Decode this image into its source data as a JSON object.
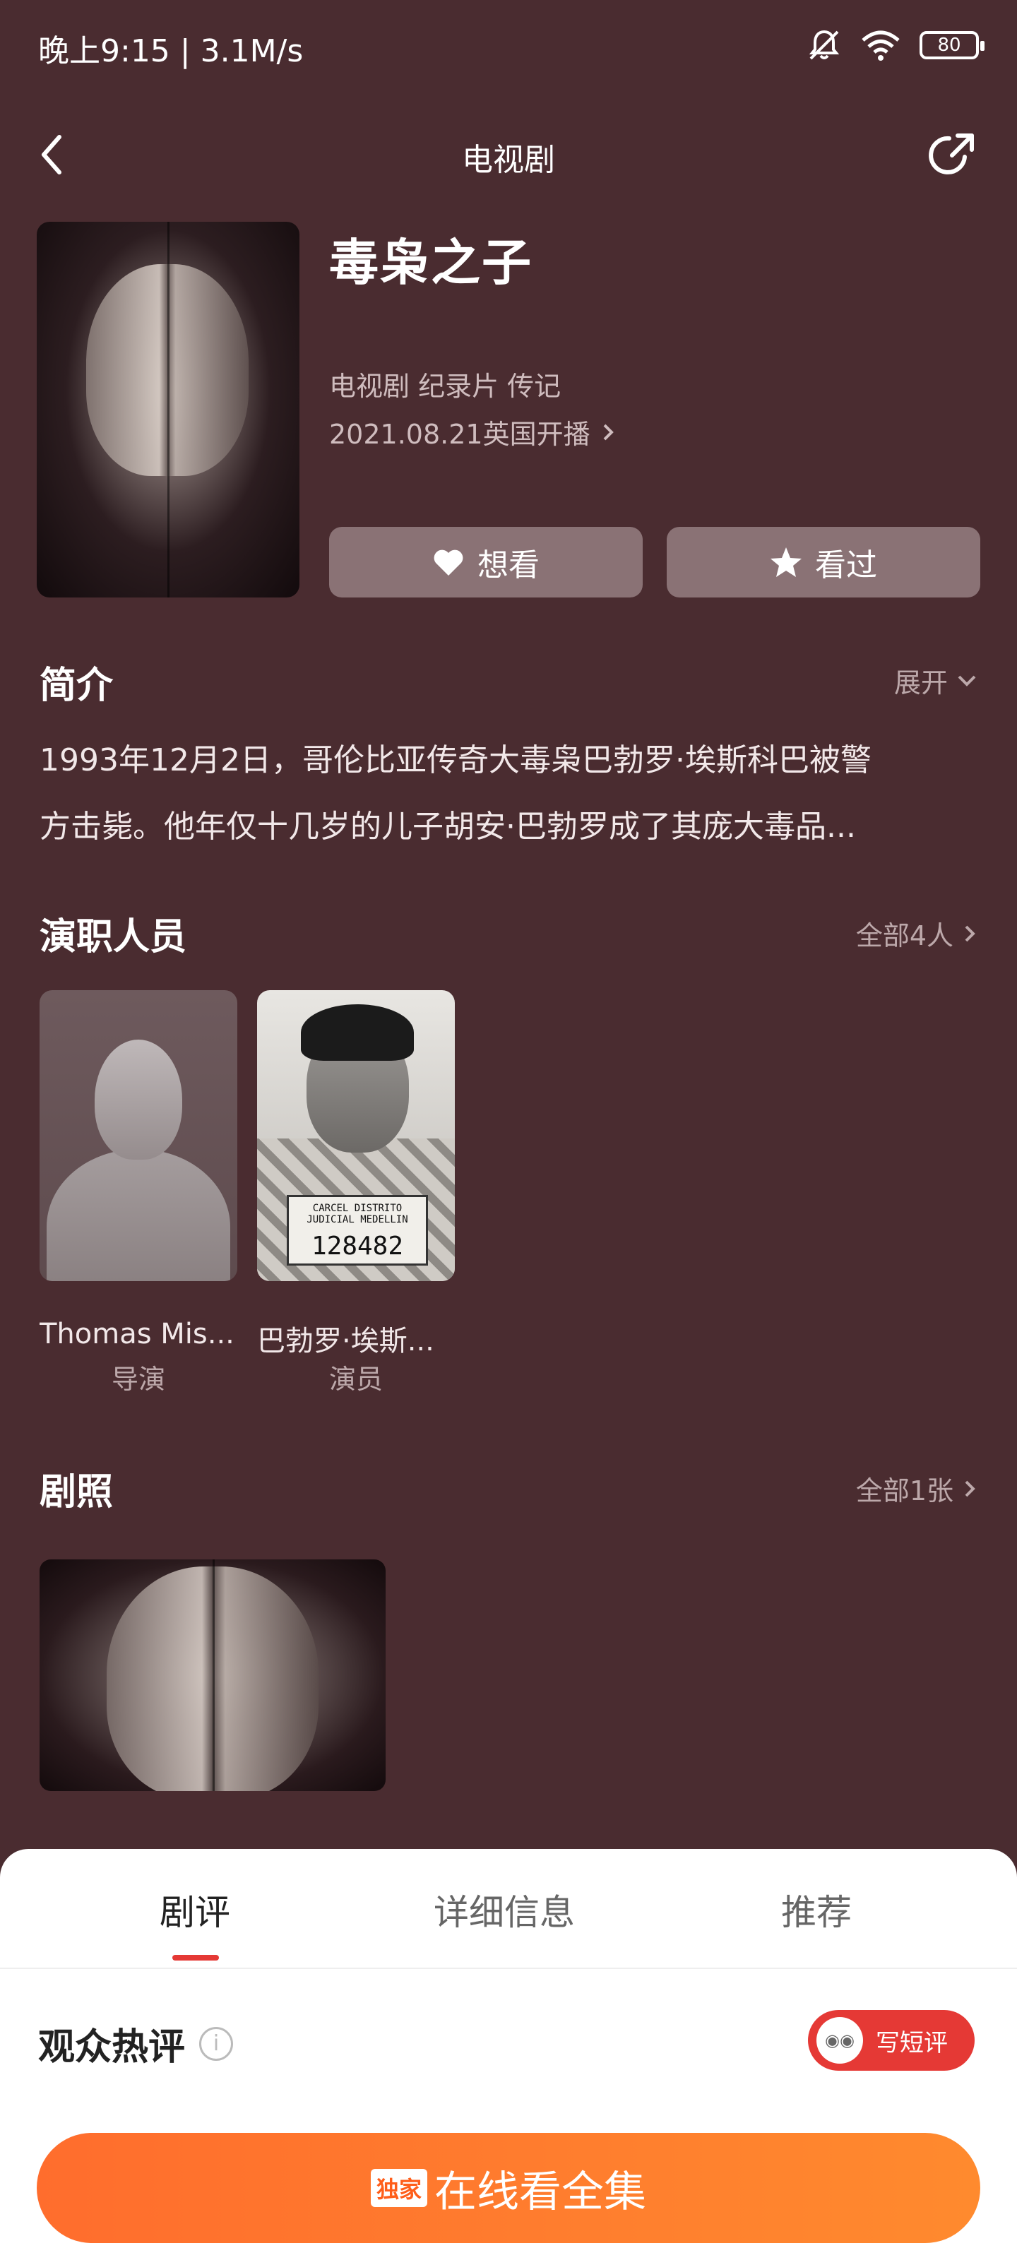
{
  "status_bar": {
    "time": "晚上9:15 | 3.1M/s",
    "battery": "80"
  },
  "nav": {
    "title": "电视剧"
  },
  "show": {
    "title": "毒枭之子",
    "genres": "电视剧 纪录片 传记",
    "release": "2021.08.21英国开播",
    "want_label": "想看",
    "seen_label": "看过"
  },
  "synopsis": {
    "title": "简介",
    "expand": "展开",
    "lines": [
      "1993年12月2日，哥伦比亚传奇大毒枭巴勃罗·埃斯科巴被警",
      "方击毙。他年仅十几岁的儿子胡安·巴勃罗成了其庞大毒品..."
    ]
  },
  "cast": {
    "title": "演职人员",
    "more": "全部4人",
    "members": [
      {
        "name": "Thomas Mis...",
        "role": "导演"
      },
      {
        "name": "巴勃罗·埃斯...",
        "role": "演员",
        "board_top": "CARCEL DISTRITO JUDICIAL MEDELLIN",
        "board_number": "128482"
      }
    ]
  },
  "stills": {
    "title": "剧照",
    "more": "全部1张"
  },
  "tabs": [
    "剧评",
    "详细信息",
    "推荐"
  ],
  "reviews": {
    "title": "观众热评",
    "write_label": "写短评"
  },
  "watch": {
    "badge": "独家",
    "label": "在线看全集"
  }
}
